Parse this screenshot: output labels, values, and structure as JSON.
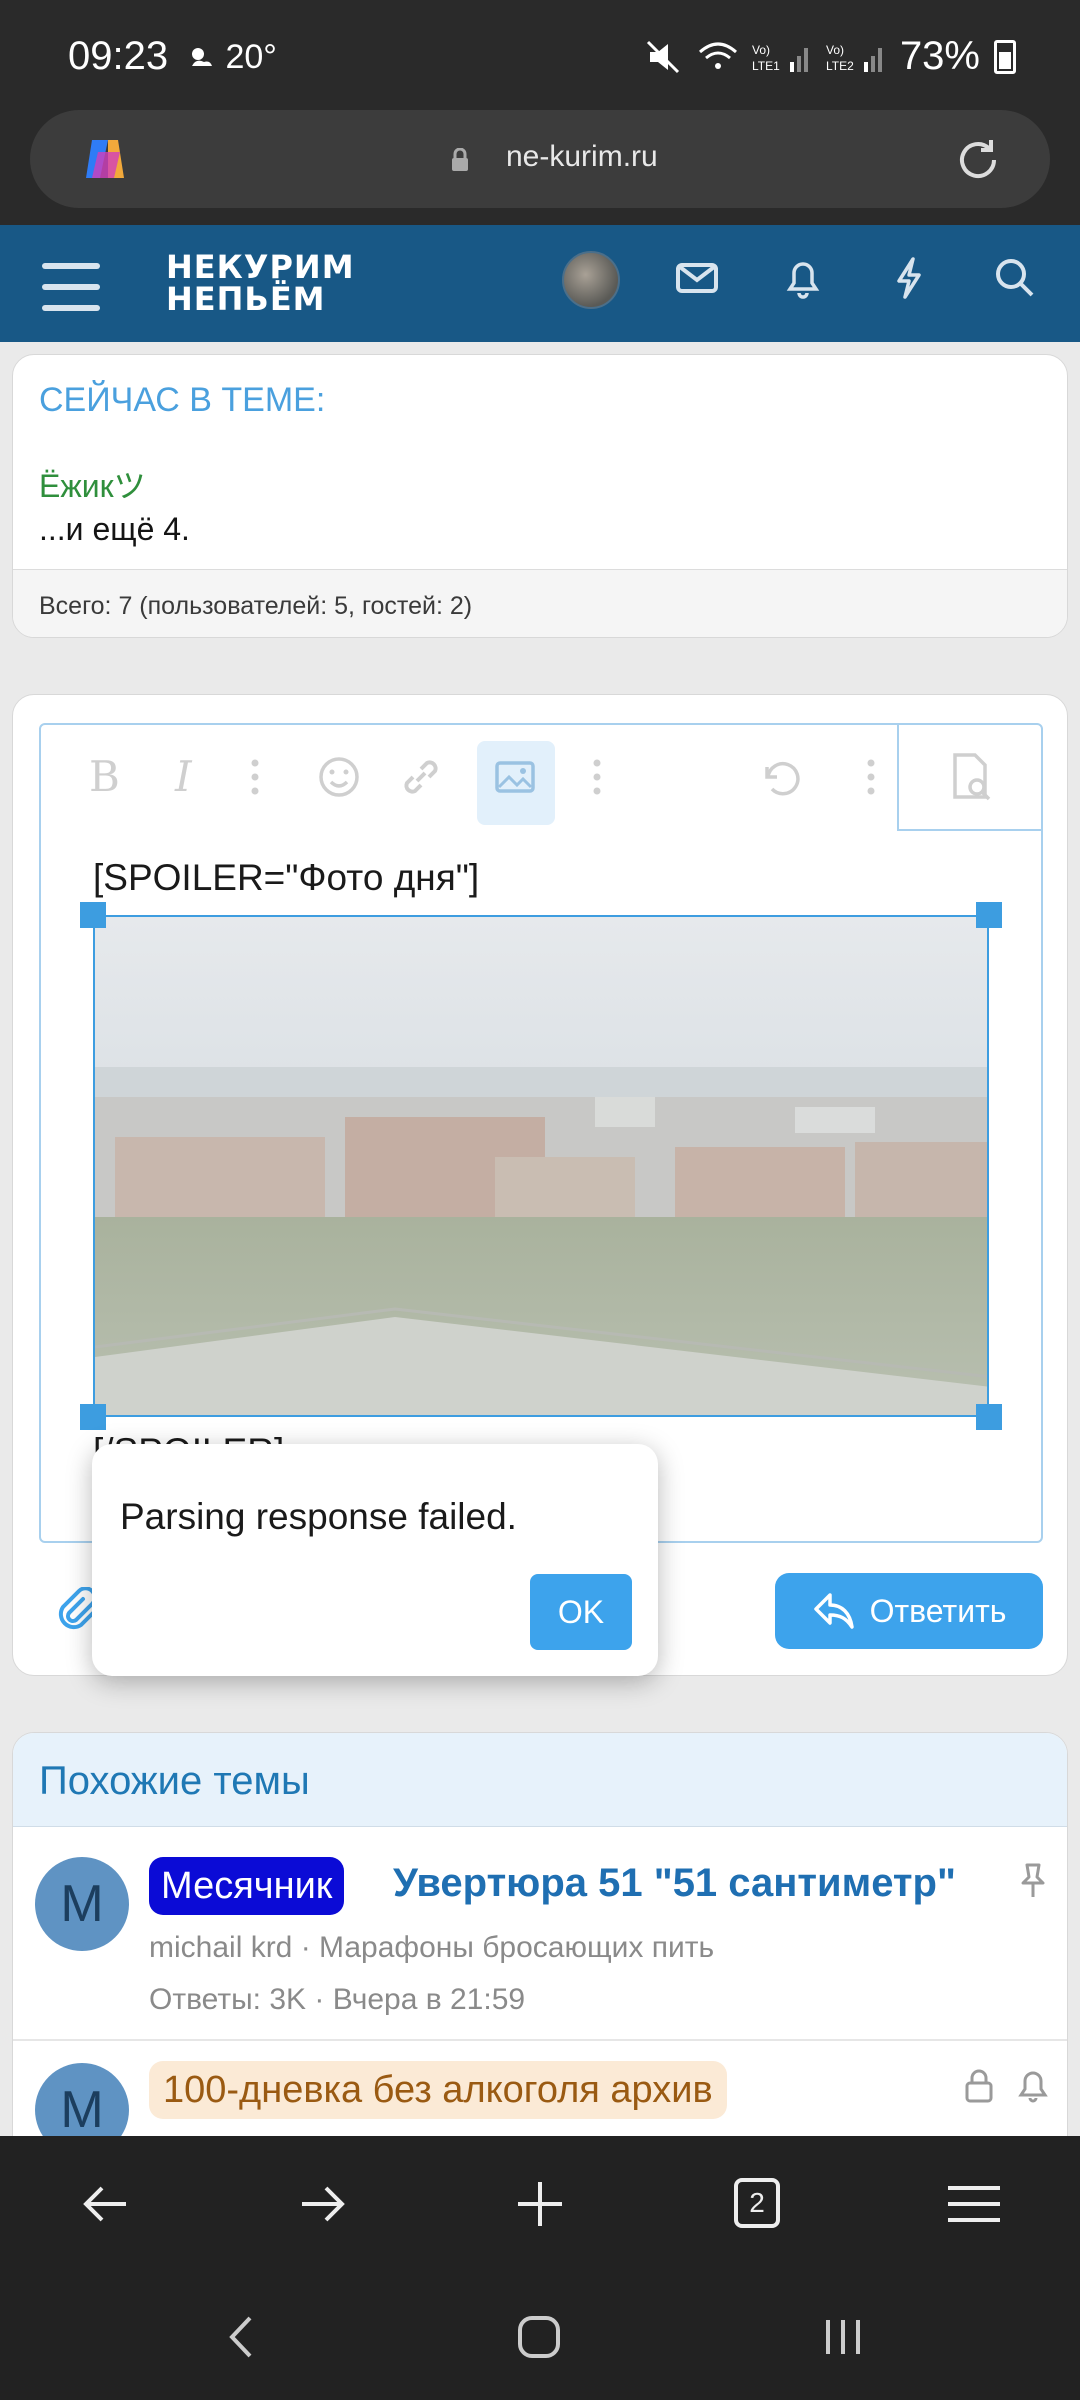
{
  "status_bar": {
    "time": "09:23",
    "temperature": "20°",
    "battery": "73%",
    "network_1": "LTE1",
    "network_2": "LTE2"
  },
  "browser": {
    "url": "ne-kurim.ru",
    "tab_count": "2"
  },
  "site": {
    "logo_line1": "НЕКУРИМ",
    "logo_line2": "НЕПЬЁМ"
  },
  "now_in_thread": {
    "title": "СЕЙЧАС В ТЕМЕ:",
    "user": "Ёжикツ",
    "more": "...и ещё 4.",
    "total": "Всего: 7 (пользователей: 5, гостей: 2)"
  },
  "editor": {
    "content_line": "[SPOILER=\"Фото дня\"]",
    "closing_line": "[/SPOILER]",
    "reply_label": "Ответить"
  },
  "dialog": {
    "message": "Parsing response failed.",
    "ok_label": "OK"
  },
  "similar": {
    "header": "Похожие темы",
    "threads": [
      {
        "avatar_letter": "M",
        "prefix": "Месячник",
        "title": "Увертюра 51 \"51 сантиметр\"",
        "meta": "michail krd · Марафоны бросающих пить",
        "stats": "Ответы: 3K · Вчера в 21:59"
      },
      {
        "avatar_letter": "M",
        "prefix": "100-дневка без алкоголя архив",
        "title": "",
        "meta": "",
        "stats": ""
      }
    ]
  },
  "colors": {
    "header_blue": "#185886",
    "accent_blue": "#3da3ec",
    "prefix_blue": "#0b0bd6",
    "online_green": "#2f8f3c"
  }
}
